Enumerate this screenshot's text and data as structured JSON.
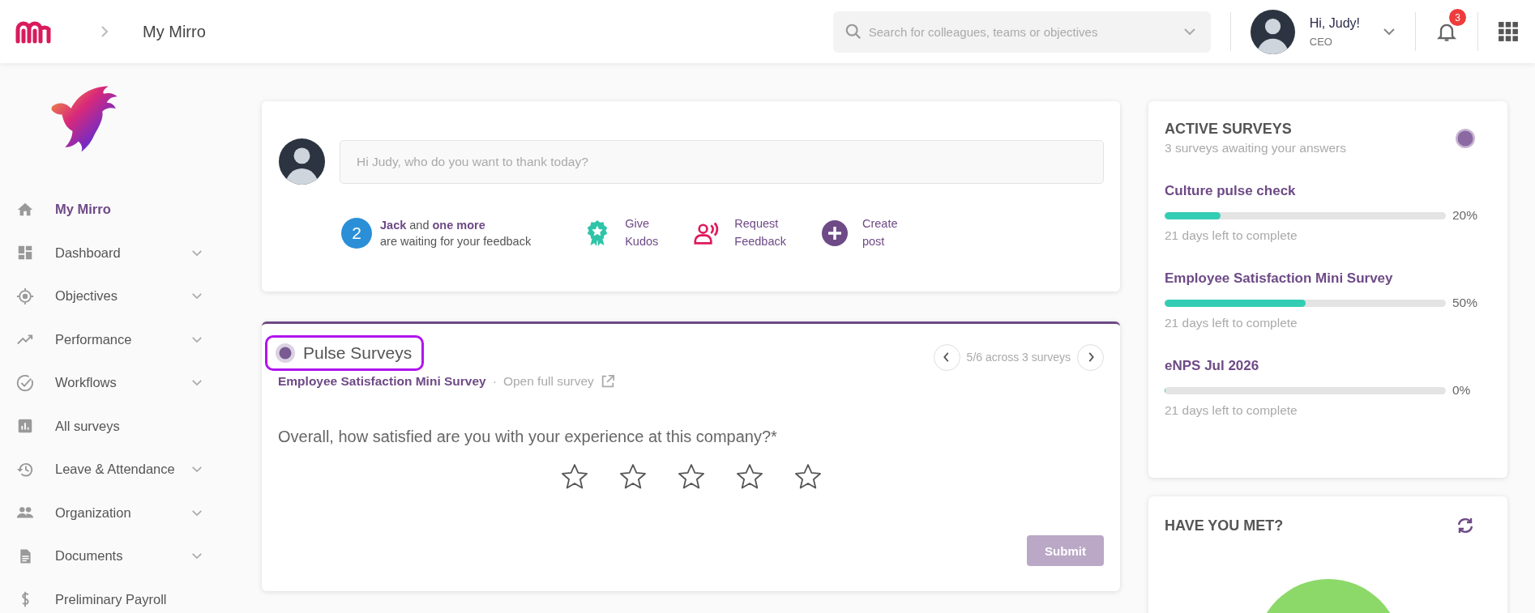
{
  "topbar": {
    "breadcrumb": "My Mirro",
    "search": {
      "placeholder": "Search for colleagues, teams or objectives"
    },
    "user": {
      "greeting": "Hi, Judy!",
      "role": "CEO"
    },
    "notifications": "3"
  },
  "sidebar": {
    "items": [
      {
        "label": "My Mirro",
        "selected": true,
        "expandable": false
      },
      {
        "label": "Dashboard",
        "selected": false,
        "expandable": true
      },
      {
        "label": "Objectives",
        "selected": false,
        "expandable": true
      },
      {
        "label": "Performance",
        "selected": false,
        "expandable": true
      },
      {
        "label": "Workflows",
        "selected": false,
        "expandable": true
      },
      {
        "label": "All surveys",
        "selected": false,
        "expandable": false
      },
      {
        "label": "Leave & Attendance",
        "selected": false,
        "expandable": true
      },
      {
        "label": "Organization",
        "selected": false,
        "expandable": true
      },
      {
        "label": "Documents",
        "selected": false,
        "expandable": true
      },
      {
        "label": "Preliminary Payroll",
        "selected": false,
        "expandable": false
      }
    ]
  },
  "feed": {
    "placeholder": "Hi Judy, who do you want to thank today?",
    "waiting": {
      "count": "2",
      "line1": "**Jack** and **one more**",
      "line2": "are waiting for your feedback"
    },
    "actions": [
      {
        "kind": "kudos",
        "label": "Give Kudos"
      },
      {
        "kind": "request",
        "label": "Request Feedback"
      },
      {
        "kind": "post",
        "label": "Create post"
      }
    ]
  },
  "pulse": {
    "title": "Pulse Surveys",
    "highlighted": true,
    "position": "5/6 across 3 surveys",
    "survey": "Employee Satisfaction Mini Survey",
    "separator": "·",
    "open_link": "Open full survey",
    "question": "Overall, how satisfied are you with your experience at this company?*",
    "stars": 0,
    "submit": {
      "label": "Submit",
      "disabled": true
    }
  },
  "active_surveys": {
    "title": "ACTIVE SURVEYS",
    "subtitle": "3 surveys awaiting your answers",
    "surveys": [
      {
        "name": "Culture pulse check",
        "level": 0.2,
        "percent": "20%",
        "due": "21 days left to complete"
      },
      {
        "name": "Employee Satisfaction Mini Survey",
        "level": 0.5,
        "percent": "50%",
        "due": "21 days left to complete"
      },
      {
        "name": "eNPS Jul 2026",
        "level": 0,
        "percent": "0%",
        "due": "21 days left to complete"
      }
    ]
  },
  "have_you_met": {
    "title": "HAVE YOU MET?"
  }
}
